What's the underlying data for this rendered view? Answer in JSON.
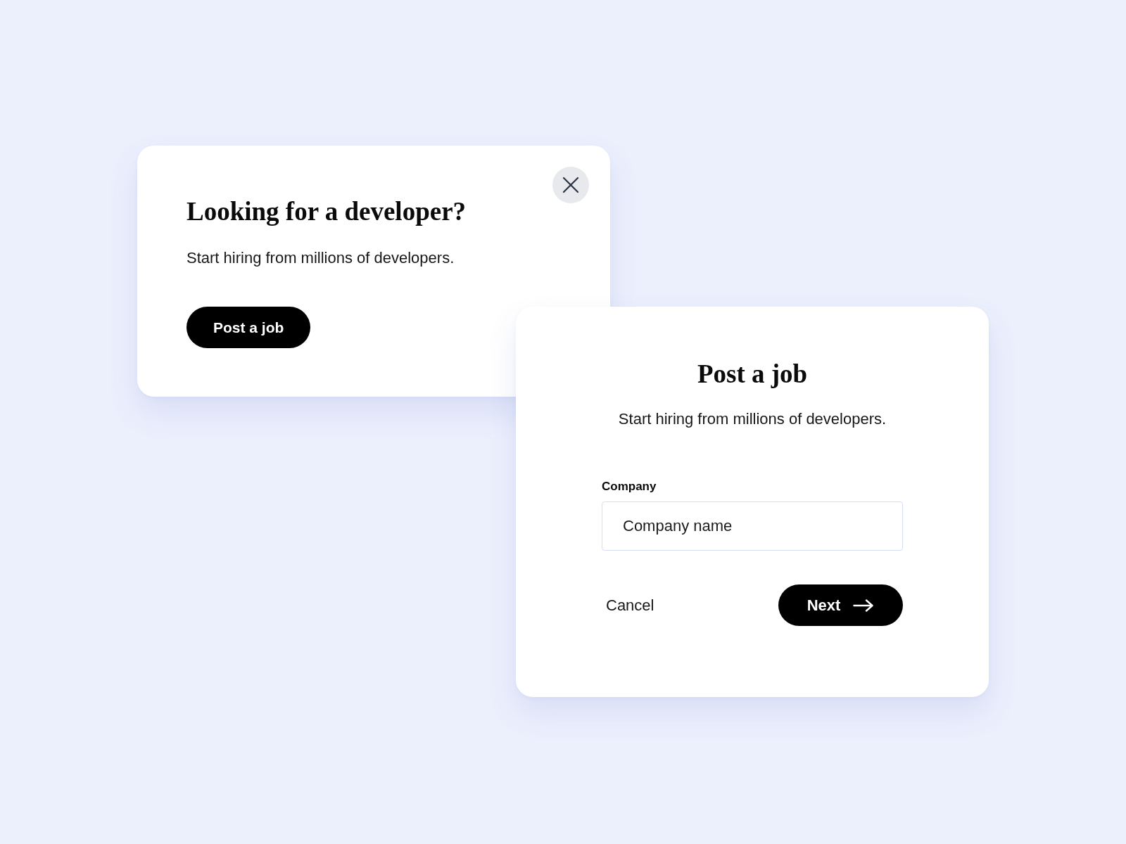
{
  "promo_card": {
    "title": "Looking for a developer?",
    "text": "Start hiring from millions of developers.",
    "button": "Post a job"
  },
  "job_dialog": {
    "title": "Post a job",
    "text": "Start hiring from millions of developers.",
    "company_field": {
      "label": "Company",
      "placeholder": "Company name"
    },
    "cancel_button": "Cancel",
    "next_button": "Next"
  }
}
